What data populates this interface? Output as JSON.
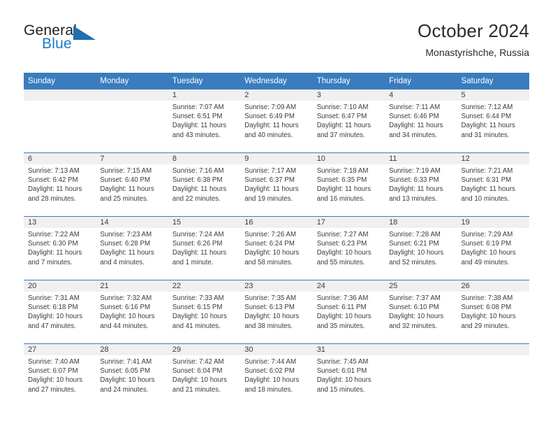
{
  "brand": {
    "name_top": "General",
    "name_bottom": "Blue",
    "color_text": "#231f20",
    "color_blue": "#1c7bc1"
  },
  "header": {
    "title": "October 2024",
    "subtitle": "Monastyrishche, Russia"
  },
  "theme": {
    "header_bar": "#3a7cbe",
    "day_band": "#f0f0f0",
    "text": "#3b3b3b"
  },
  "calendar": {
    "weekdays": [
      "Sunday",
      "Monday",
      "Tuesday",
      "Wednesday",
      "Thursday",
      "Friday",
      "Saturday"
    ],
    "weeks": [
      [
        {
          "day": "",
          "sunrise": "",
          "sunset": "",
          "daylight": ""
        },
        {
          "day": "",
          "sunrise": "",
          "sunset": "",
          "daylight": ""
        },
        {
          "day": "1",
          "sunrise": "Sunrise: 7:07 AM",
          "sunset": "Sunset: 6:51 PM",
          "daylight": "Daylight: 11 hours and 43 minutes."
        },
        {
          "day": "2",
          "sunrise": "Sunrise: 7:09 AM",
          "sunset": "Sunset: 6:49 PM",
          "daylight": "Daylight: 11 hours and 40 minutes."
        },
        {
          "day": "3",
          "sunrise": "Sunrise: 7:10 AM",
          "sunset": "Sunset: 6:47 PM",
          "daylight": "Daylight: 11 hours and 37 minutes."
        },
        {
          "day": "4",
          "sunrise": "Sunrise: 7:11 AM",
          "sunset": "Sunset: 6:46 PM",
          "daylight": "Daylight: 11 hours and 34 minutes."
        },
        {
          "day": "5",
          "sunrise": "Sunrise: 7:12 AM",
          "sunset": "Sunset: 6:44 PM",
          "daylight": "Daylight: 11 hours and 31 minutes."
        }
      ],
      [
        {
          "day": "6",
          "sunrise": "Sunrise: 7:13 AM",
          "sunset": "Sunset: 6:42 PM",
          "daylight": "Daylight: 11 hours and 28 minutes."
        },
        {
          "day": "7",
          "sunrise": "Sunrise: 7:15 AM",
          "sunset": "Sunset: 6:40 PM",
          "daylight": "Daylight: 11 hours and 25 minutes."
        },
        {
          "day": "8",
          "sunrise": "Sunrise: 7:16 AM",
          "sunset": "Sunset: 6:38 PM",
          "daylight": "Daylight: 11 hours and 22 minutes."
        },
        {
          "day": "9",
          "sunrise": "Sunrise: 7:17 AM",
          "sunset": "Sunset: 6:37 PM",
          "daylight": "Daylight: 11 hours and 19 minutes."
        },
        {
          "day": "10",
          "sunrise": "Sunrise: 7:18 AM",
          "sunset": "Sunset: 6:35 PM",
          "daylight": "Daylight: 11 hours and 16 minutes."
        },
        {
          "day": "11",
          "sunrise": "Sunrise: 7:19 AM",
          "sunset": "Sunset: 6:33 PM",
          "daylight": "Daylight: 11 hours and 13 minutes."
        },
        {
          "day": "12",
          "sunrise": "Sunrise: 7:21 AM",
          "sunset": "Sunset: 6:31 PM",
          "daylight": "Daylight: 11 hours and 10 minutes."
        }
      ],
      [
        {
          "day": "13",
          "sunrise": "Sunrise: 7:22 AM",
          "sunset": "Sunset: 6:30 PM",
          "daylight": "Daylight: 11 hours and 7 minutes."
        },
        {
          "day": "14",
          "sunrise": "Sunrise: 7:23 AM",
          "sunset": "Sunset: 6:28 PM",
          "daylight": "Daylight: 11 hours and 4 minutes."
        },
        {
          "day": "15",
          "sunrise": "Sunrise: 7:24 AM",
          "sunset": "Sunset: 6:26 PM",
          "daylight": "Daylight: 11 hours and 1 minute."
        },
        {
          "day": "16",
          "sunrise": "Sunrise: 7:26 AM",
          "sunset": "Sunset: 6:24 PM",
          "daylight": "Daylight: 10 hours and 58 minutes."
        },
        {
          "day": "17",
          "sunrise": "Sunrise: 7:27 AM",
          "sunset": "Sunset: 6:23 PM",
          "daylight": "Daylight: 10 hours and 55 minutes."
        },
        {
          "day": "18",
          "sunrise": "Sunrise: 7:28 AM",
          "sunset": "Sunset: 6:21 PM",
          "daylight": "Daylight: 10 hours and 52 minutes."
        },
        {
          "day": "19",
          "sunrise": "Sunrise: 7:29 AM",
          "sunset": "Sunset: 6:19 PM",
          "daylight": "Daylight: 10 hours and 49 minutes."
        }
      ],
      [
        {
          "day": "20",
          "sunrise": "Sunrise: 7:31 AM",
          "sunset": "Sunset: 6:18 PM",
          "daylight": "Daylight: 10 hours and 47 minutes."
        },
        {
          "day": "21",
          "sunrise": "Sunrise: 7:32 AM",
          "sunset": "Sunset: 6:16 PM",
          "daylight": "Daylight: 10 hours and 44 minutes."
        },
        {
          "day": "22",
          "sunrise": "Sunrise: 7:33 AM",
          "sunset": "Sunset: 6:15 PM",
          "daylight": "Daylight: 10 hours and 41 minutes."
        },
        {
          "day": "23",
          "sunrise": "Sunrise: 7:35 AM",
          "sunset": "Sunset: 6:13 PM",
          "daylight": "Daylight: 10 hours and 38 minutes."
        },
        {
          "day": "24",
          "sunrise": "Sunrise: 7:36 AM",
          "sunset": "Sunset: 6:11 PM",
          "daylight": "Daylight: 10 hours and 35 minutes."
        },
        {
          "day": "25",
          "sunrise": "Sunrise: 7:37 AM",
          "sunset": "Sunset: 6:10 PM",
          "daylight": "Daylight: 10 hours and 32 minutes."
        },
        {
          "day": "26",
          "sunrise": "Sunrise: 7:38 AM",
          "sunset": "Sunset: 6:08 PM",
          "daylight": "Daylight: 10 hours and 29 minutes."
        }
      ],
      [
        {
          "day": "27",
          "sunrise": "Sunrise: 7:40 AM",
          "sunset": "Sunset: 6:07 PM",
          "daylight": "Daylight: 10 hours and 27 minutes."
        },
        {
          "day": "28",
          "sunrise": "Sunrise: 7:41 AM",
          "sunset": "Sunset: 6:05 PM",
          "daylight": "Daylight: 10 hours and 24 minutes."
        },
        {
          "day": "29",
          "sunrise": "Sunrise: 7:42 AM",
          "sunset": "Sunset: 6:04 PM",
          "daylight": "Daylight: 10 hours and 21 minutes."
        },
        {
          "day": "30",
          "sunrise": "Sunrise: 7:44 AM",
          "sunset": "Sunset: 6:02 PM",
          "daylight": "Daylight: 10 hours and 18 minutes."
        },
        {
          "day": "31",
          "sunrise": "Sunrise: 7:45 AM",
          "sunset": "Sunset: 6:01 PM",
          "daylight": "Daylight: 10 hours and 15 minutes."
        },
        {
          "day": "",
          "sunrise": "",
          "sunset": "",
          "daylight": ""
        },
        {
          "day": "",
          "sunrise": "",
          "sunset": "",
          "daylight": ""
        }
      ]
    ]
  }
}
